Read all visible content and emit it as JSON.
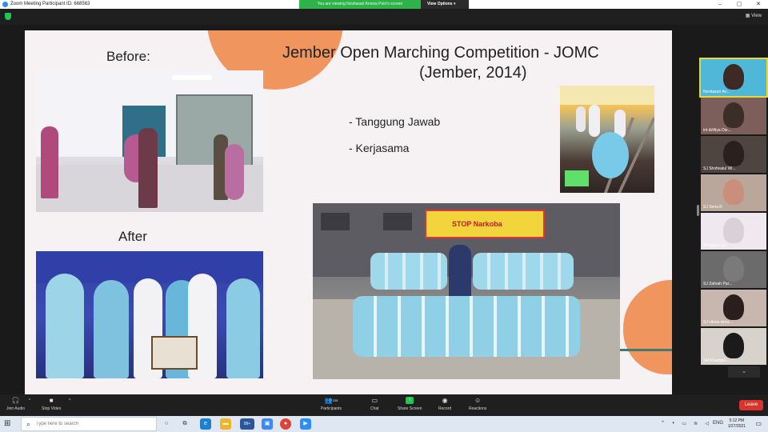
{
  "window": {
    "title": "Zoom Meeting Participant ID: 668563"
  },
  "banner": {
    "message": "You are viewing Novitasari Annisa Putri's screen",
    "view_options": "View Options ▾"
  },
  "meeting": {
    "view_label": "View"
  },
  "slide": {
    "before_label": "Before:",
    "after_label": "After",
    "title_line1": "Jember Open Marching Competition - JOMC",
    "title_line2": "(Jember, 2014)",
    "bullets": [
      "- Tanggung Jawab",
      "- Kerjasama"
    ],
    "banner_sign": "STOP Narkoba"
  },
  "participants": [
    {
      "name": "Novitasari An...",
      "face": "#3e2a24",
      "bg": "#4fb8d8"
    },
    {
      "name": "int di/Alya Die...",
      "face": "#3b2d28",
      "bg": "#7c5f5a"
    },
    {
      "name": "SJ Shofwatul Wi...",
      "face": "#2b201d",
      "bg": "#4f4540"
    },
    {
      "name": "SJ Xena R",
      "face": "#c98f7b",
      "bg": "#b9a79c"
    },
    {
      "name": "Shillgalyn sa...",
      "face": "#d9d0d8",
      "bg": "#efe8ef"
    },
    {
      "name": "SJ Zahrah Par...",
      "face": "#7a7a7a",
      "bg": "#6b6b6b"
    },
    {
      "name": "SJ vilona isma...",
      "face": "#2a1f1c",
      "bg": "#c7b7ae"
    },
    {
      "name": "SM Khadijah ...",
      "face": "#1b1b1b",
      "bg": "#d8d2cc"
    }
  ],
  "toolbar": {
    "join_audio": "Join Audio",
    "stop_video": "Stop Video",
    "participants": "Participants",
    "participants_count": "235",
    "chat": "Chat",
    "share_screen": "Share Screen",
    "record": "Record",
    "reactions": "Reactions",
    "leave": "Leave"
  },
  "taskbar": {
    "search_placeholder": "Type here to search",
    "notification_count": "99+",
    "language": "ENG",
    "time": "5:12 PM",
    "date": "1/27/2021"
  },
  "colors": {
    "accent": "#2D8CFF",
    "share_green": "#23C552",
    "leave_red": "#D9332B",
    "slide_blob": "#F0955E"
  }
}
